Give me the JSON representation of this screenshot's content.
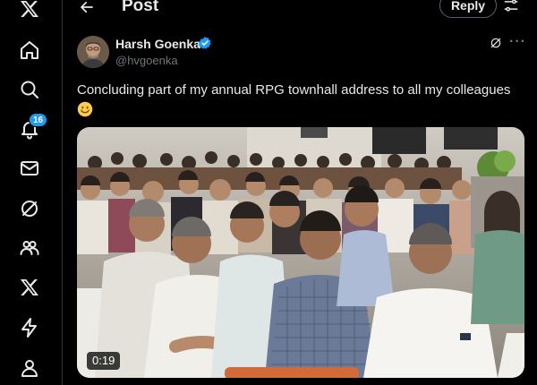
{
  "nav": {
    "items": [
      {
        "icon": "x-logo-icon"
      },
      {
        "icon": "home-icon"
      },
      {
        "icon": "search-icon"
      },
      {
        "icon": "notifications-icon",
        "badge": "16"
      },
      {
        "icon": "messages-icon"
      },
      {
        "icon": "grok-icon"
      },
      {
        "icon": "communities-icon"
      },
      {
        "icon": "premium-icon"
      },
      {
        "icon": "verified-orgs-icon"
      },
      {
        "icon": "profile-icon"
      }
    ]
  },
  "header": {
    "title": "Post",
    "reply_label": "Reply"
  },
  "post": {
    "author_name": "Harsh Goenka",
    "author_handle": "@hvgoenka",
    "text": "Concluding part of my annual RPG townhall address to all my colleagues",
    "video_timestamp": "0:19"
  },
  "colors": {
    "accent": "#1d9bf0",
    "background": "#000000",
    "text": "#e7e9ea",
    "muted": "#71767b"
  }
}
